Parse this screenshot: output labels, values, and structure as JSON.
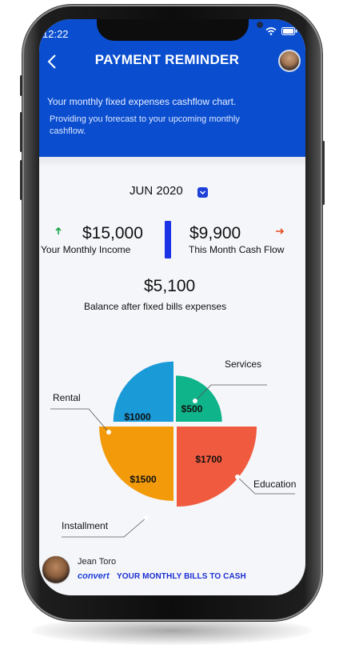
{
  "status": {
    "time": "12:22"
  },
  "header": {
    "title": "PAYMENT REMINDER",
    "subtitle": "Your monthly fixed expenses cashflow chart.",
    "description": "Providing you forecast to your upcoming monthly cashflow."
  },
  "period": {
    "label": "JUN 2020"
  },
  "summary": {
    "income_value": "$15,000",
    "income_label": "Your Monthly Income",
    "cashflow_value": "$9,900",
    "cashflow_label": "This Month Cash Flow",
    "balance_value": "$5,100",
    "balance_label": "Balance after fixed bills expenses"
  },
  "chart_data": {
    "type": "pie",
    "slices": [
      {
        "label": "Services",
        "value": 500,
        "display": "$500",
        "color": "#10b48a"
      },
      {
        "label": "Education",
        "value": 1700,
        "display": "$1700",
        "color": "#f05a3e"
      },
      {
        "label": "Installment",
        "value": 1500,
        "display": "$1500",
        "color": "#f29a0a"
      },
      {
        "label": "Rental",
        "value": 1000,
        "display": "$1000",
        "color": "#1a9bd8"
      }
    ]
  },
  "footer": {
    "name": "Jean Toro",
    "brand": "convert",
    "tagline": "YOUR MONTHLY BILLS TO CASH"
  },
  "colors": {
    "header_bg": "#0a4ecf",
    "accent": "#1b33e6",
    "income_arrow": "#17a64a",
    "cashflow_arrow": "#e34a1d"
  },
  "icons": {
    "signal": "signal-icon",
    "wifi": "wifi-icon",
    "battery": "battery-icon",
    "back": "back-arrow-icon",
    "month_toggle": "chevron-down-icon",
    "income_arrow": "arrow-up-icon",
    "cashflow_arrow": "arrow-right-icon"
  }
}
